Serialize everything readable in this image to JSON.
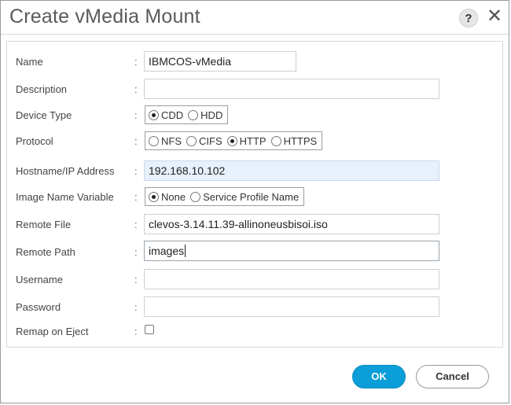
{
  "dialog": {
    "title": "Create vMedia Mount",
    "help_label": "?",
    "close_label": "✕"
  },
  "form": {
    "name": {
      "label": "Name",
      "value": "IBMCOS-vMedia"
    },
    "description": {
      "label": "Description",
      "value": ""
    },
    "device_type": {
      "label": "Device Type",
      "options": [
        "CDD",
        "HDD"
      ],
      "selected": "CDD"
    },
    "protocol": {
      "label": "Protocol",
      "options": [
        "NFS",
        "CIFS",
        "HTTP",
        "HTTPS"
      ],
      "selected": "HTTP"
    },
    "hostname": {
      "label": "Hostname/IP Address",
      "value": "192.168.10.102"
    },
    "image_name_variable": {
      "label": "Image Name Variable",
      "options": [
        "None",
        "Service Profile Name"
      ],
      "selected": "None"
    },
    "remote_file": {
      "label": "Remote File",
      "value": "clevos-3.14.11.39-allinoneusbisoi.iso"
    },
    "remote_path": {
      "label": "Remote Path",
      "value": "images"
    },
    "username": {
      "label": "Username",
      "value": ""
    },
    "password": {
      "label": "Password",
      "value": ""
    },
    "remap_on_eject": {
      "label": "Remap on Eject",
      "checked": false
    },
    "colon": ":"
  },
  "buttons": {
    "ok": "OK",
    "cancel": "Cancel"
  },
  "colors": {
    "primary": "#0c9ed9",
    "filled_input_bg": "#e7f0fb"
  }
}
